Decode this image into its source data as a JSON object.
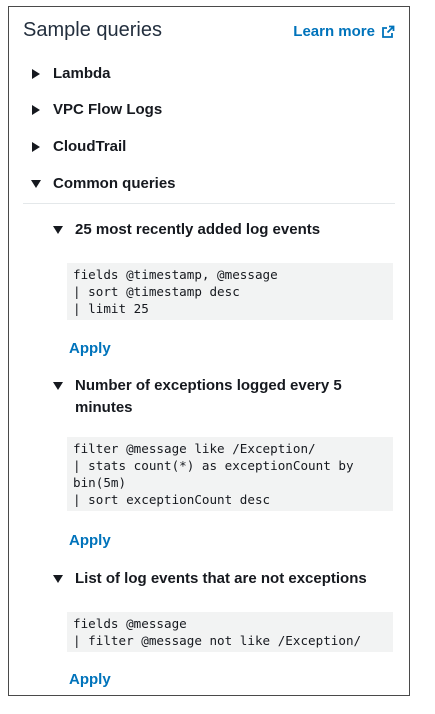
{
  "panel": {
    "title": "Sample queries",
    "learn_more": "Learn more"
  },
  "sections": [
    {
      "label": "Lambda",
      "expanded": false
    },
    {
      "label": "VPC Flow Logs",
      "expanded": false
    },
    {
      "label": "CloudTrail",
      "expanded": false
    },
    {
      "label": "Common queries",
      "expanded": true
    }
  ],
  "queries": [
    {
      "title": "25 most recently added log events",
      "code": "fields @timestamp, @message\n| sort @timestamp desc\n| limit 25",
      "apply": "Apply"
    },
    {
      "title": "Number of exceptions logged every 5 minutes",
      "code": "filter @message like /Exception/\n| stats count(*) as exceptionCount by\nbin(5m)\n| sort exceptionCount desc",
      "apply": "Apply"
    },
    {
      "title": "List of log events that are not exceptions",
      "code": "fields @message\n| filter @message not like /Exception/",
      "apply": "Apply"
    }
  ],
  "colors": {
    "link": "#0073bb",
    "code_bg": "#f2f3f3",
    "text": "#16191f"
  }
}
